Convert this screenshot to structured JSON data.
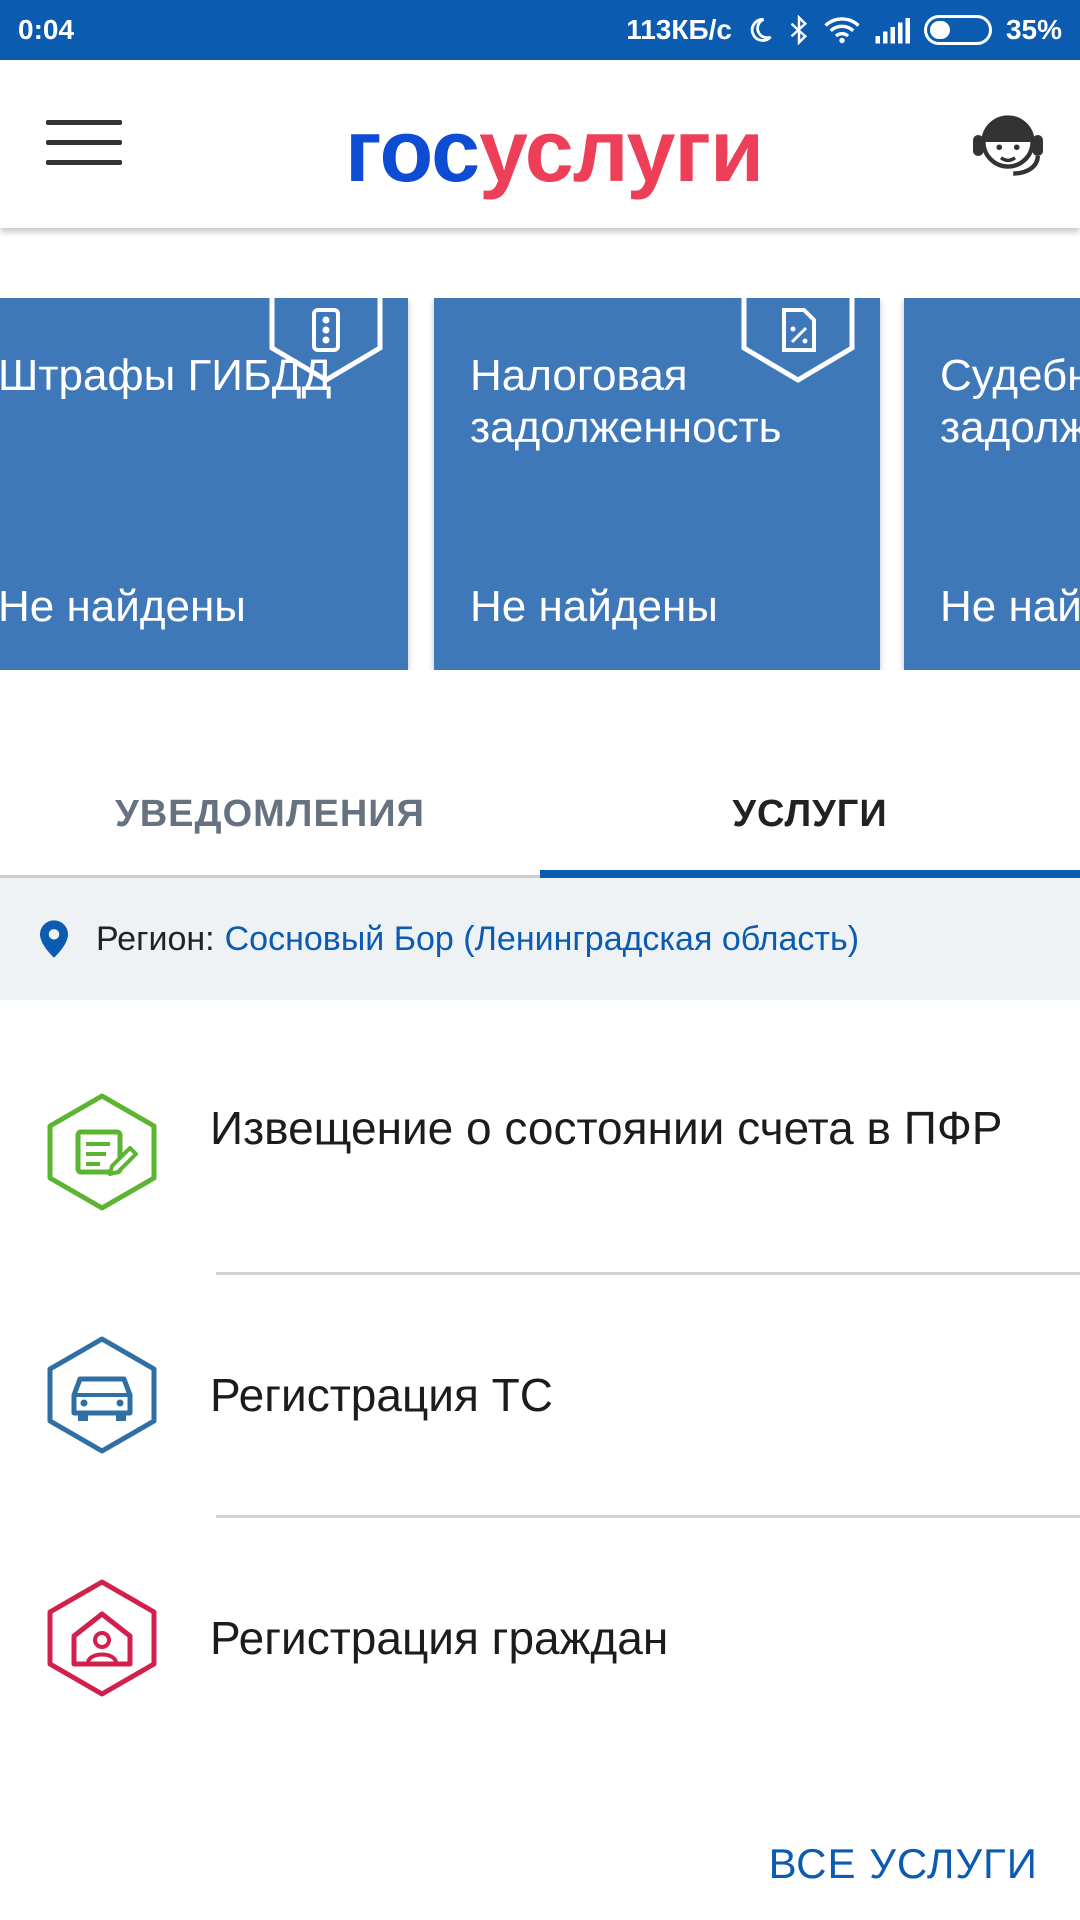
{
  "status_bar": {
    "time": "0:04",
    "network_speed": "113КБ/с",
    "battery_percent": "35%",
    "battery_level": 0.35,
    "icons": [
      "moon-icon",
      "bluetooth-icon",
      "wifi-icon",
      "signal-icon",
      "battery-icon"
    ]
  },
  "header": {
    "logo_part1": "гос",
    "logo_part2": "услуги",
    "menu_icon": "hamburger-menu-icon",
    "support_icon": "support-operator-icon",
    "colors": {
      "logo_blue": "#0d4cd3",
      "logo_red": "#ee3f58"
    }
  },
  "cards": [
    {
      "title": "Штрафы ГИБДД",
      "status": "Не найдены",
      "icon": "traffic-light-icon"
    },
    {
      "title": "Налоговая задолженность",
      "status": "Не найдены",
      "icon": "tax-document-icon"
    },
    {
      "title": "Судебная задолженность",
      "status": "Не найдены"
    }
  ],
  "tabs": [
    {
      "label": "УВЕДОМЛЕНИЯ",
      "active": false
    },
    {
      "label": "УСЛУГИ",
      "active": true
    }
  ],
  "region": {
    "label": "Регион:",
    "value": "Сосновый Бор (Ленинградская область)",
    "icon": "location-pin-icon"
  },
  "services": [
    {
      "name": "Извещение о состоянии счета в ПФР",
      "icon": "document-edit-icon",
      "color": "#5cb531"
    },
    {
      "name": "Регистрация ТС",
      "icon": "car-icon",
      "color": "#2f6fa3"
    },
    {
      "name": "Регистрация граждан",
      "icon": "house-person-icon",
      "color": "#d2204c"
    }
  ],
  "all_services_label": "ВСЕ УСЛУГИ",
  "colors": {
    "primary": "#0b5bb0",
    "card_bg": "#3f78b8"
  }
}
